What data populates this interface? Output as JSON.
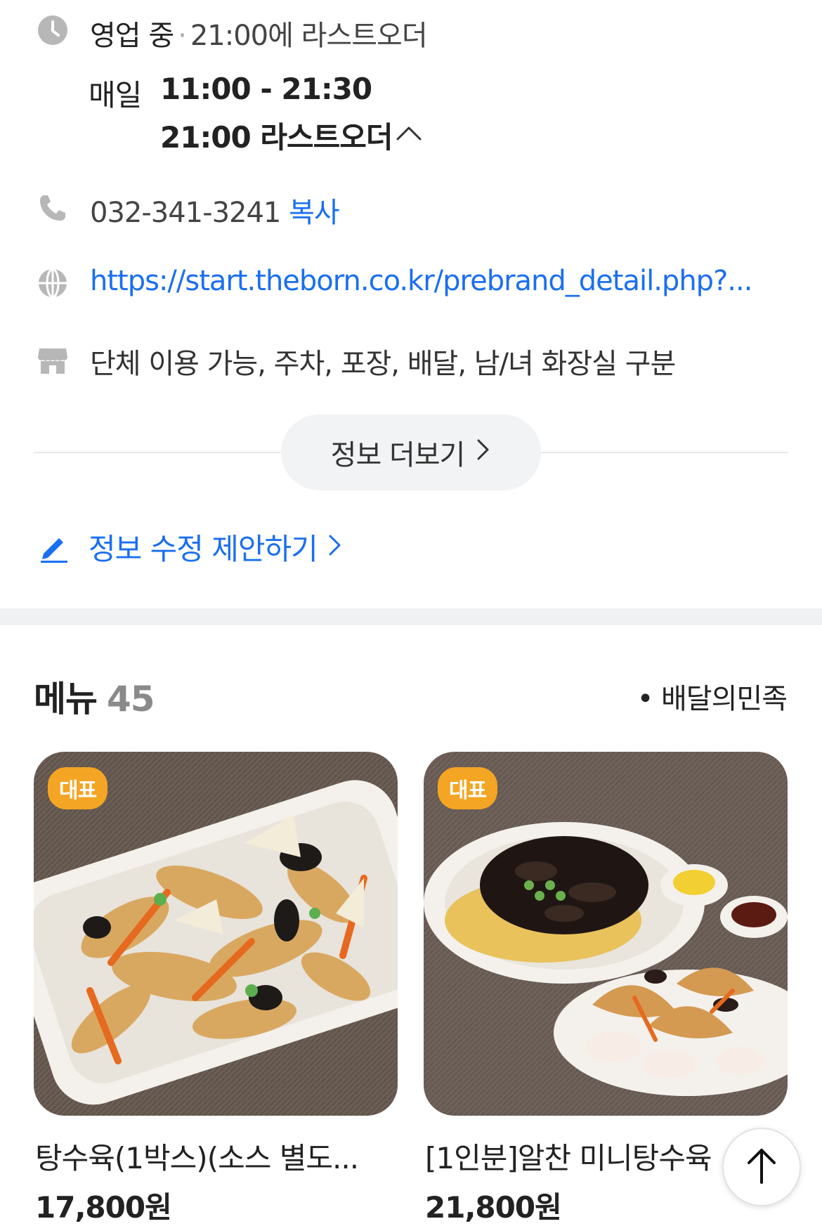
{
  "info": {
    "status": "영업 중",
    "separator": "·",
    "last_order_summary": "21:00에 라스트오더",
    "days_label": "매일",
    "hours": "11:00 - 21:30",
    "last_order_detail": "21:00 라스트오더",
    "phone": "032-341-3241",
    "copy_label": "복사",
    "website": "https://start.theborn.co.kr/prebrand_detail.php?...",
    "amenities": "단체 이용 가능, 주차, 포장, 배달, 남/녀 화장실 구분",
    "more_button": "정보 더보기",
    "suggest_edit": "정보 수정 제안하기"
  },
  "menu": {
    "title": "메뉴",
    "count": "45",
    "source_bullet": "•",
    "source": "배달의민족",
    "items": [
      {
        "badge": "대표",
        "name": "탕수육(1박스)(소스 별도...",
        "price": "17,800원"
      },
      {
        "badge": "대표",
        "name": "[1인분]알찬 미니탕수육",
        "price": "21,800원"
      }
    ]
  },
  "icons": {
    "clock": "clock-icon",
    "phone": "phone-icon",
    "globe": "globe-icon",
    "store": "store-icon",
    "pencil": "pencil-icon",
    "chevron_up": "chevron-up-icon",
    "chevron_right": "chevron-right-icon",
    "arrow_up": "arrow-up-icon"
  },
  "colors": {
    "link": "#1a6ff0",
    "badge": "#f5a524",
    "icon_gray": "#b7b7b7"
  }
}
